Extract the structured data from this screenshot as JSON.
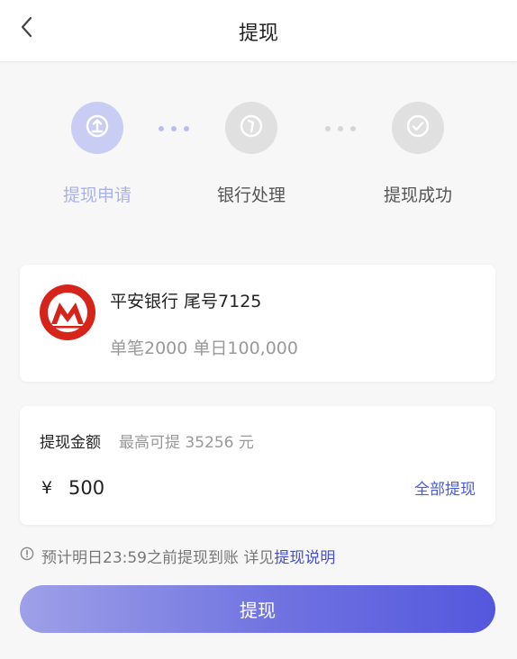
{
  "header": {
    "title": "提现"
  },
  "steps": [
    {
      "label": "提现申请",
      "icon": "upload-icon",
      "state": "active"
    },
    {
      "label": "银行处理",
      "icon": "clock-icon",
      "state": "inactive"
    },
    {
      "label": "提现成功",
      "icon": "check-icon",
      "state": "inactive"
    }
  ],
  "bank": {
    "name": "平安银行 尾号7125",
    "limit": "单笔2000 单日100,000",
    "logo_icon": "bank-logo-icon"
  },
  "amount": {
    "label": "提现金额",
    "max_text": "最高可提 35256 元",
    "currency": "¥",
    "value": "500",
    "withdraw_all_label": "全部提现"
  },
  "tip": {
    "text": "预计明日23:59之前提现到账 详见",
    "link": "提现说明"
  },
  "submit_label": "提现",
  "colors": {
    "accent": "#4a5bd8",
    "step_active": "#c9cdf3",
    "step_inactive": "#e0e0e0",
    "bank_red": "#d7241b"
  }
}
